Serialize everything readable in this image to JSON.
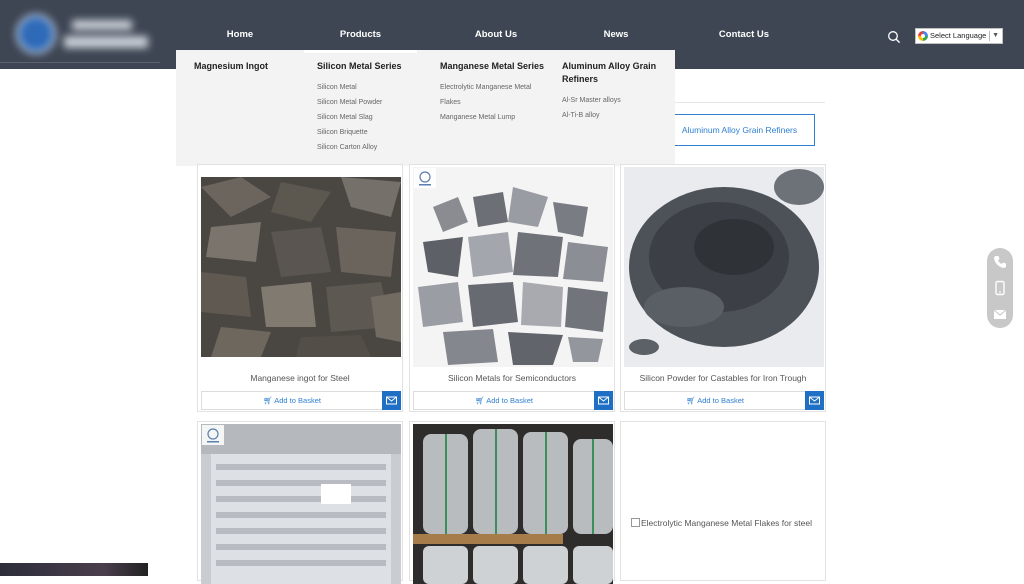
{
  "nav": {
    "items": [
      {
        "label": "Home"
      },
      {
        "label": "Products"
      },
      {
        "label": "About Us"
      },
      {
        "label": "News"
      },
      {
        "label": "Contact Us"
      }
    ],
    "language": "Select Language"
  },
  "mega_menu": {
    "columns": [
      {
        "title": "Magnesium Ingot",
        "items": []
      },
      {
        "title": "Silicon Metal Series",
        "items": [
          "Silicon Metal",
          "Silicon Metal Powder",
          "Silicon Metal Slag",
          "Silicon Briquette",
          "Silicon Carton Alloy"
        ]
      },
      {
        "title": "Manganese Metal Series",
        "items": [
          "Electrolytic Manganese Metal Flakes",
          "Manganese Metal Lump"
        ]
      },
      {
        "title": "Aluminum Alloy Grain Refiners",
        "items": [
          "Al-Sr Master alloys",
          "Al-Ti-B alloy"
        ]
      }
    ]
  },
  "category_button": "Aluminum Alloy Grain Refiners",
  "products": [
    {
      "title": "Manganese ingot for Steel",
      "basket": "Add to Basket"
    },
    {
      "title": "Silicon Metals for Semiconductors",
      "basket": "Add to Basket"
    },
    {
      "title": "Silicon Powder for Castables for Iron Trough",
      "basket": "Add to Basket"
    },
    {
      "title": "",
      "basket": ""
    },
    {
      "title": "",
      "basket": ""
    },
    {
      "title": "Electrolytic Manganese Metal Flakes for steel",
      "basket": ""
    }
  ],
  "colors": {
    "header": "#3e4654",
    "accent": "#2f7fd0",
    "mail_button": "#1f6fc5"
  }
}
